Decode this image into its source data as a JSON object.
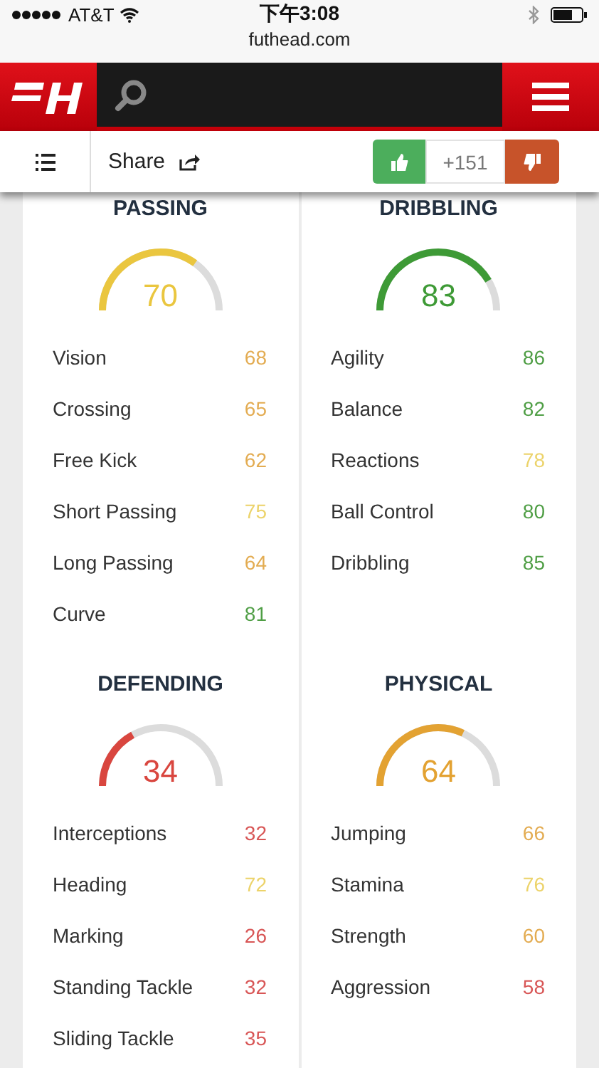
{
  "status_bar": {
    "carrier": "AT&T",
    "time": "下午3:08"
  },
  "url_bar": {
    "url": "futhead.com"
  },
  "toolbar": {
    "share": "Share",
    "votes": "+151"
  },
  "sections": [
    {
      "title": "PASSING",
      "rating": "70",
      "color": "#eac63f",
      "stats": [
        {
          "name": "Vision",
          "value": "68",
          "color": "#e3ac52"
        },
        {
          "name": "Crossing",
          "value": "65",
          "color": "#e3ac52"
        },
        {
          "name": "Free Kick",
          "value": "62",
          "color": "#e3ac52"
        },
        {
          "name": "Short Passing",
          "value": "75",
          "color": "#ecd36a"
        },
        {
          "name": "Long Passing",
          "value": "64",
          "color": "#e3ac52"
        },
        {
          "name": "Curve",
          "value": "81",
          "color": "#4f9e45"
        }
      ]
    },
    {
      "title": "DRIBBLING",
      "rating": "83",
      "color": "#3e9a36",
      "stats": [
        {
          "name": "Agility",
          "value": "86",
          "color": "#4f9e45"
        },
        {
          "name": "Balance",
          "value": "82",
          "color": "#4f9e45"
        },
        {
          "name": "Reactions",
          "value": "78",
          "color": "#ecd36a"
        },
        {
          "name": "Ball Control",
          "value": "80",
          "color": "#4f9e45"
        },
        {
          "name": "Dribbling",
          "value": "85",
          "color": "#4f9e45"
        }
      ]
    },
    {
      "title": "DEFENDING",
      "rating": "34",
      "color": "#d9463f",
      "stats": [
        {
          "name": "Interceptions",
          "value": "32",
          "color": "#d85656"
        },
        {
          "name": "Heading",
          "value": "72",
          "color": "#ecd36a"
        },
        {
          "name": "Marking",
          "value": "26",
          "color": "#d85656"
        },
        {
          "name": "Standing Tackle",
          "value": "32",
          "color": "#d85656"
        },
        {
          "name": "Sliding Tackle",
          "value": "35",
          "color": "#d85656"
        }
      ]
    },
    {
      "title": "PHYSICAL",
      "rating": "64",
      "color": "#e3a232",
      "stats": [
        {
          "name": "Jumping",
          "value": "66",
          "color": "#e3ac52"
        },
        {
          "name": "Stamina",
          "value": "76",
          "color": "#ecd36a"
        },
        {
          "name": "Strength",
          "value": "60",
          "color": "#e3ac52"
        },
        {
          "name": "Aggression",
          "value": "58",
          "color": "#d85656"
        }
      ]
    }
  ]
}
